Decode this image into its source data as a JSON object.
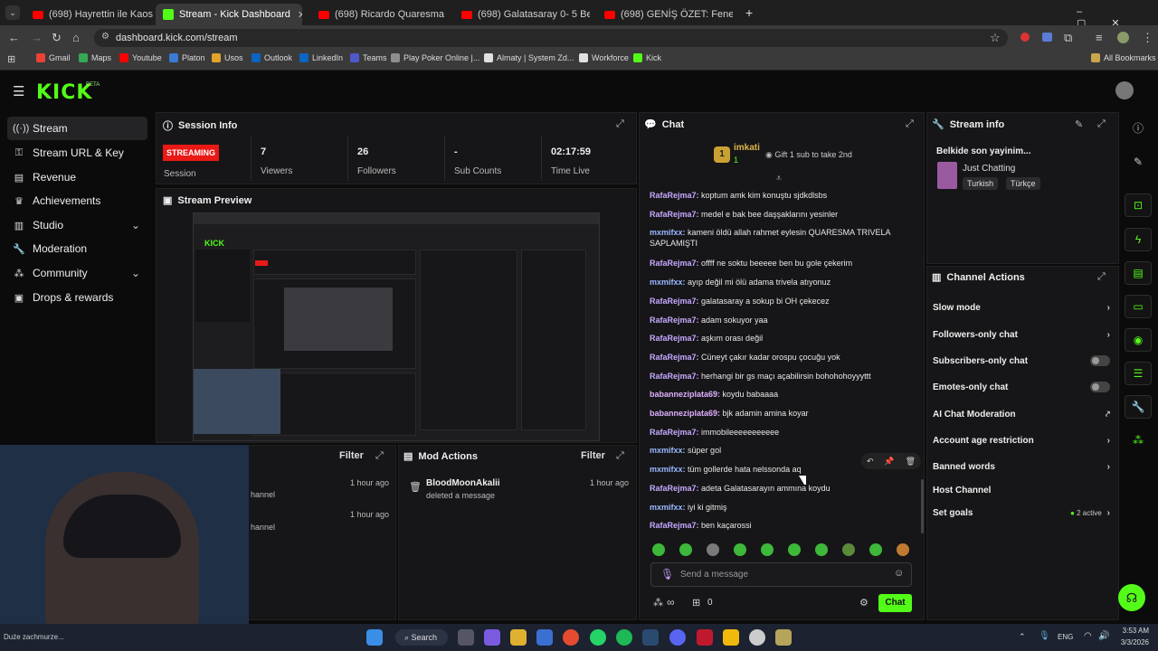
{
  "browser": {
    "tabs": [
      {
        "title": "(698) Hayrettin ile Kaos Show -",
        "kind": "yt"
      },
      {
        "title": "Stream - Kick Dashboard",
        "kind": "kick",
        "active": true
      },
      {
        "title": "(698) Ricardo Quaresma | Foun",
        "kind": "yt"
      },
      {
        "title": "(698) Galatasaray 0- 5 Beşiktaş",
        "kind": "yt"
      },
      {
        "title": "(698) GENİŞ ÖZET: Fenerbahçe",
        "kind": "yt"
      }
    ],
    "url": "dashboard.kick.com/stream",
    "bookmarks": [
      "Gmail",
      "Maps",
      "Youtube",
      "Platon",
      "Usos",
      "Outlook",
      "LinkedIn",
      "Teams",
      "Play Poker Online |...",
      "Almaty | System Zd...",
      "Workforce",
      "Kick"
    ],
    "all_bookmarks": "All Bookmarks"
  },
  "brand": {
    "logo": "KICK",
    "beta": "BETA"
  },
  "sidebar": {
    "items": [
      {
        "label": "Stream",
        "icon": "signal-icon"
      },
      {
        "label": "Stream URL & Key",
        "icon": "key-icon"
      },
      {
        "label": "Revenue",
        "icon": "revenue-icon"
      },
      {
        "label": "Achievements",
        "icon": "trophy-icon"
      },
      {
        "label": "Studio",
        "icon": "studio-icon"
      },
      {
        "label": "Moderation",
        "icon": "wrench-icon"
      },
      {
        "label": "Community",
        "icon": "community-icon"
      },
      {
        "label": "Drops & rewards",
        "icon": "gift-icon"
      }
    ]
  },
  "session": {
    "title": "Session Info",
    "status_badge": "STREAMING",
    "status_label": "Session",
    "viewers": "7",
    "viewers_label": "Viewers",
    "followers": "26",
    "followers_label": "Followers",
    "subs": "-",
    "subs_label": "Sub Counts",
    "live": "02:17:59",
    "live_label": "Time Live"
  },
  "preview": {
    "title": "Stream Preview"
  },
  "bottom_left": {
    "filter": "Filter",
    "items": [
      {
        "text": "hannel",
        "time": "1 hour ago"
      },
      {
        "text": "hannel",
        "time": "1 hour ago"
      }
    ]
  },
  "mod_actions": {
    "title": "Mod Actions",
    "filter": "Filter",
    "items": [
      {
        "user": "BloodMoonAkalii",
        "action": "deleted a message",
        "time": "1 hour ago"
      }
    ]
  },
  "chat": {
    "title": "Chat",
    "pinned_user": "imkati",
    "pinned_count": "1",
    "gift_text": "Gift 1 sub to take 2nd",
    "messages": [
      {
        "user": "RafaRejma7",
        "text": "koptum amk kim konuştu sjdkdlsbs",
        "c": "u1"
      },
      {
        "user": "RafaRejma7",
        "text": "medel e bak bee daşşaklarını yesinler",
        "c": "u1"
      },
      {
        "user": "mxmifxx",
        "text": "kameni öldü allah rahmet eylesin QUARESMA TRIVELA SAPLAMIŞTI",
        "c": "u2"
      },
      {
        "user": "RafaRejma7",
        "text": "offff ne soktu beeeee ben bu gole çekerim",
        "c": "u1"
      },
      {
        "user": "mxmifxx",
        "text": "ayıp değil mi ölü adama trivela atıyonuz",
        "c": "u2"
      },
      {
        "user": "RafaRejma7",
        "text": "galatasaray a sokup bi OH çekecez",
        "c": "u1"
      },
      {
        "user": "RafaRejma7",
        "text": "adam sokuyor yaa",
        "c": "u1"
      },
      {
        "user": "RafaRejma7",
        "text": "aşkım orası değil",
        "c": "u1"
      },
      {
        "user": "RafaRejma7",
        "text": "Cüneyt çakır kadar orospu çocuğu yok",
        "c": "u1"
      },
      {
        "user": "RafaRejma7",
        "text": "herhangi bir gs maçı açabilirsin bohohohoyyyttt",
        "c": "u1"
      },
      {
        "user": "babanneziplata69",
        "text": "koydu babaaaa",
        "c": "u3"
      },
      {
        "user": "babanneziplata69",
        "text": "bjk adamin amina koyar",
        "c": "u3"
      },
      {
        "user": "RafaRejma7",
        "text": "immobileeeeeeeeeee",
        "c": "u1"
      },
      {
        "user": "mxmifxx",
        "text": "süper gol",
        "c": "u2"
      },
      {
        "user": "mxmifxx",
        "text": "tüm gollerde hata nelssonda aq",
        "c": "u2"
      },
      {
        "user": "RafaRejma7",
        "text": "adeta Galatasarayın ammına koydu",
        "c": "u1"
      },
      {
        "user": "mxmifxx",
        "text": "iyi ki gitmiş",
        "c": "u2"
      },
      {
        "user": "RafaRejma7",
        "text": "ben kaçarossi",
        "c": "u1"
      }
    ],
    "input_placeholder": "Send a message",
    "infinite": "∞",
    "points": "0",
    "send_label": "Chat"
  },
  "stream_info": {
    "title": "Stream info",
    "stream_title": "Belkide son yayinim...",
    "category": "Just Chatting",
    "tags": [
      "Turkish",
      "Türkçe"
    ]
  },
  "channel_actions": {
    "title": "Channel Actions",
    "rows": [
      {
        "label": "Slow mode",
        "ctrl": "chevron"
      },
      {
        "label": "Followers-only chat",
        "ctrl": "chevron"
      },
      {
        "label": "Subscribers-only chat",
        "ctrl": "toggle"
      },
      {
        "label": "Emotes-only chat",
        "ctrl": "toggle"
      },
      {
        "label": "AI Chat Moderation",
        "ctrl": "external"
      },
      {
        "label": "Account age restriction",
        "ctrl": "chevron"
      },
      {
        "label": "Banned words",
        "ctrl": "chevron"
      },
      {
        "label": "Host Channel",
        "ctrl": "none"
      },
      {
        "label": "Set goals",
        "ctrl": "chevron",
        "status": "2 active"
      }
    ]
  },
  "taskbar": {
    "search": "Search",
    "lang": "ENG",
    "time": "3:53 AM",
    "date": "3/3/2026",
    "overlay_label": "Duże zachmurze..."
  },
  "colors": {
    "accent": "#53fc18",
    "live": "#e91916"
  }
}
